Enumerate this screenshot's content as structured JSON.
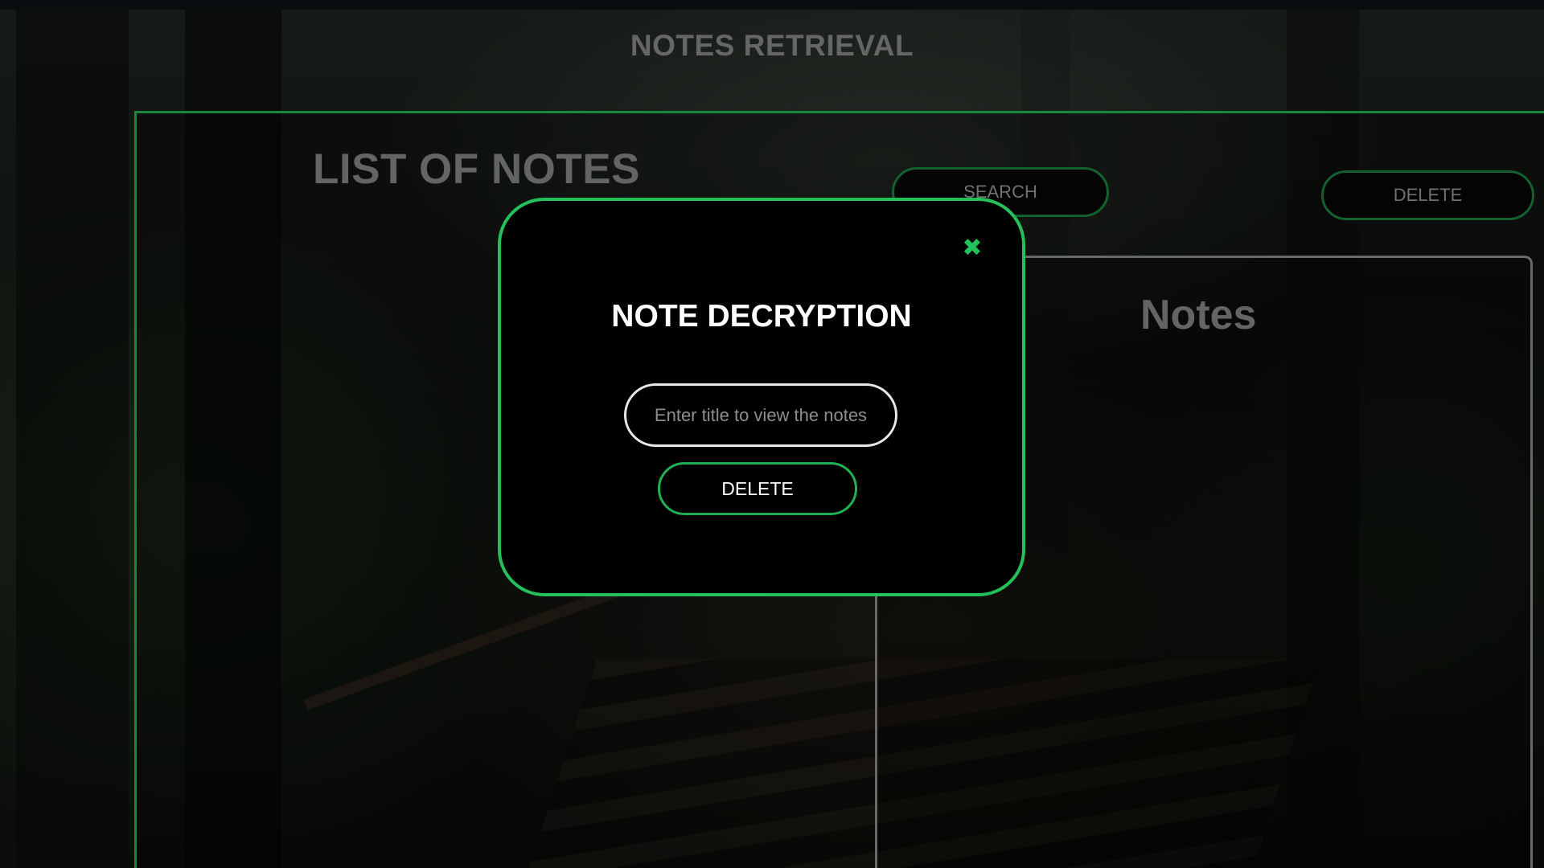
{
  "page": {
    "title": "NOTES RETRIEVAL"
  },
  "list_panel": {
    "title": "LIST OF NOTES"
  },
  "toolbar": {
    "search_label": "SEARCH",
    "delete_label": "DELETE"
  },
  "notes_panel": {
    "title": "Notes"
  },
  "modal": {
    "title": "NOTE DECRYPTION",
    "close_glyph": "✖",
    "input_placeholder": "Enter title to view the notes",
    "input_value": "",
    "delete_label": "DELETE"
  },
  "colors": {
    "accent_green": "#25c05a",
    "panel_border_green": "#1fa64a",
    "muted_text": "#7a7a7a",
    "modal_bg": "#000000"
  },
  "icons": {
    "close": "close-icon"
  }
}
